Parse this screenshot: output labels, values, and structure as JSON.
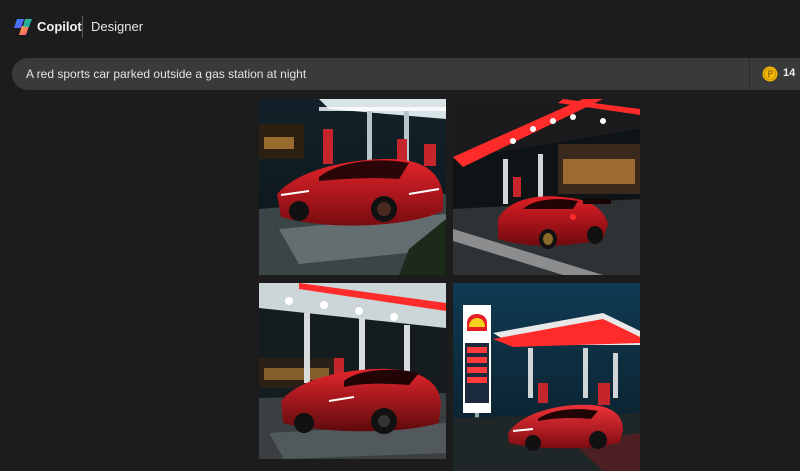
{
  "header": {
    "brand": "Copilot",
    "product": "Designer"
  },
  "prompt": {
    "text": "A red sports car parked outside a gas station at night"
  },
  "boosts": {
    "icon": "coin-icon",
    "count": "14"
  },
  "images": [
    {
      "name": "generated-image-1"
    },
    {
      "name": "generated-image-2"
    },
    {
      "name": "generated-image-3"
    },
    {
      "name": "generated-image-4"
    }
  ],
  "colors": {
    "background": "#1c1c1c",
    "prompt_bar": "#3a3a3a",
    "coin": "#f2b705",
    "car_red": "#c8121c"
  }
}
